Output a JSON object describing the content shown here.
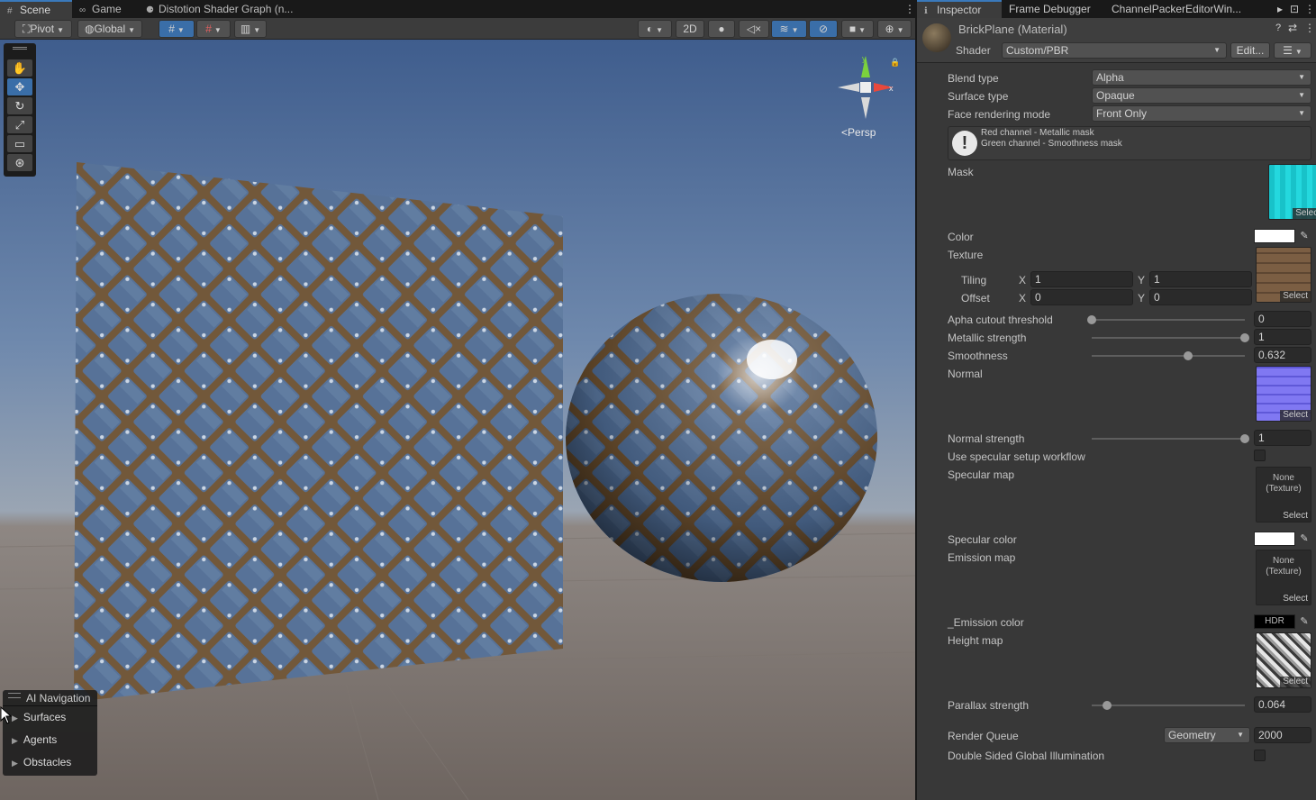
{
  "scene_tabs": [
    {
      "icon": "#",
      "label": "Scene"
    },
    {
      "icon": "∞",
      "label": "Game"
    },
    {
      "icon": "⚈",
      "label": "Distotion Shader Graph (n..."
    }
  ],
  "scene_toolbar": {
    "pivot": "Pivot",
    "global": "Global",
    "mode_2d": "2D"
  },
  "scene_view": {
    "persp_label": "Persp",
    "gizmo_y": "y",
    "gizmo_x": "x"
  },
  "ai_navigation": {
    "title": "AI Navigation",
    "items": [
      "Surfaces",
      "Agents",
      "Obstacles"
    ]
  },
  "inspector_tabs": [
    {
      "icon": "ℹ",
      "label": "Inspector"
    },
    {
      "icon": "",
      "label": "Frame Debugger"
    },
    {
      "icon": "",
      "label": "ChannelPackerEditorWin..."
    }
  ],
  "material": {
    "name": "BrickPlane (Material)",
    "shader_label": "Shader",
    "shader_value": "Custom/PBR",
    "edit_button": "Edit..."
  },
  "properties": {
    "blend_type": {
      "label": "Blend type",
      "value": "Alpha"
    },
    "surface_type": {
      "label": "Surface type",
      "value": "Opaque"
    },
    "face_rendering": {
      "label": "Face rendering mode",
      "value": "Front Only"
    },
    "help_lines": [
      "Red channel - Metallic mask",
      "Green channel - Smoothness mask"
    ],
    "mask": {
      "label": "Mask"
    },
    "color": {
      "label": "Color",
      "value": "#ffffff"
    },
    "texture": {
      "label": "Texture"
    },
    "tiling": {
      "label": "Tiling",
      "x_label": "X",
      "x": "1",
      "y_label": "Y",
      "y": "1"
    },
    "offset": {
      "label": "Offset",
      "x_label": "X",
      "x": "0",
      "y_label": "Y",
      "y": "0"
    },
    "alpha_cutout": {
      "label": "Apha cutout threshold",
      "value": "0",
      "fraction": 0.0
    },
    "metallic": {
      "label": "Metallic strength",
      "value": "1",
      "fraction": 1.0
    },
    "smoothness": {
      "label": "Smoothness",
      "value": "0.632",
      "fraction": 0.632
    },
    "normal": {
      "label": "Normal"
    },
    "normal_strength": {
      "label": "Normal strength",
      "value": "1",
      "fraction": 1.0
    },
    "specular_workflow": {
      "label": "Use specular setup workflow"
    },
    "specular_map": {
      "label": "Specular map",
      "none_text": "None\n(Texture)"
    },
    "specular_color": {
      "label": "Specular color",
      "value": "#ffffff"
    },
    "emission_map": {
      "label": "Emission map",
      "none_text": "None\n(Texture)"
    },
    "emission_color": {
      "label": "_Emission color",
      "hdr": "HDR"
    },
    "height_map": {
      "label": "Height map"
    },
    "parallax": {
      "label": "Parallax strength",
      "value": "0.064",
      "fraction": 0.1
    },
    "render_queue": {
      "label": "Render Queue",
      "dropdown": "Geometry",
      "value": "2000"
    },
    "double_sided_gi": {
      "label": "Double Sided Global Illumination"
    },
    "select_label": "Select"
  }
}
